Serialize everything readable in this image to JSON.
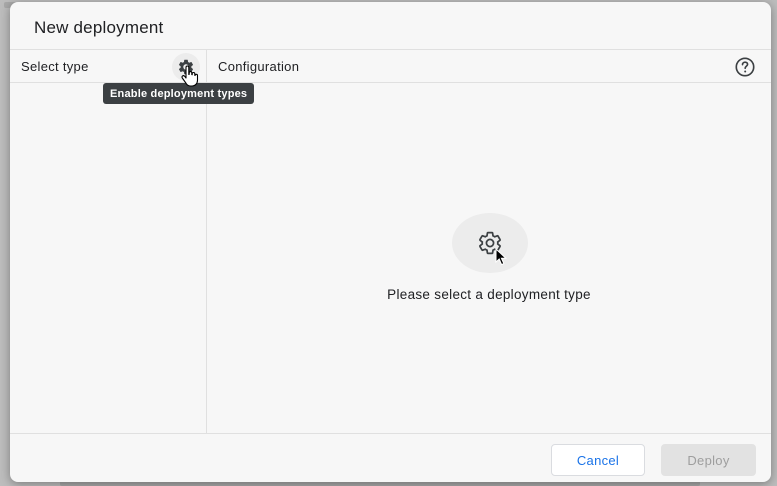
{
  "dialog": {
    "title": "New deployment"
  },
  "left_panel": {
    "header": "Select type",
    "settings_icon": "gear-icon",
    "tooltip": "Enable deployment types"
  },
  "right_panel": {
    "header": "Configuration",
    "help_icon": "help-circle-icon",
    "empty_state_icon": "gear-icon",
    "empty_state_text": "Please select a deployment type"
  },
  "footer": {
    "cancel_label": "Cancel",
    "deploy_label": "Deploy"
  },
  "colors": {
    "accent": "#1a73e8",
    "tooltip_bg": "#3c4043",
    "disabled_bg": "#e2e2e2",
    "disabled_text": "#9e9e9e"
  }
}
